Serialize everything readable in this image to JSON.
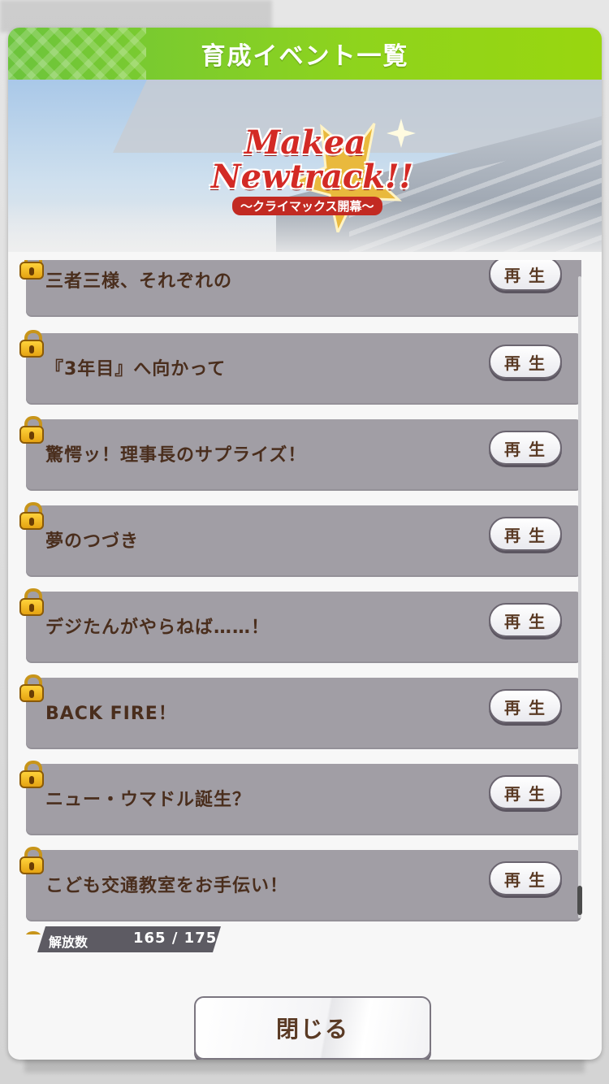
{
  "dialog": {
    "title": "育成イベント一覧"
  },
  "banner": {
    "logo_line1": "Makea",
    "logo_line2": "Newtrack!!",
    "logo_subtitle": "〜クライマックス開幕〜"
  },
  "events": [
    {
      "label": "三者三様、それぞれの",
      "play_label": "再生"
    },
    {
      "label": "『3年目』へ向かって",
      "play_label": "再生"
    },
    {
      "label": "驚愕ッ！理事長のサプライズ！",
      "play_label": "再生"
    },
    {
      "label": "夢のつづき",
      "play_label": "再生"
    },
    {
      "label": "デジたんがやらねば……！",
      "play_label": "再生"
    },
    {
      "label": "BACK FIRE！",
      "play_label": "再生"
    },
    {
      "label": "ニュー・ウマドル誕生？",
      "play_label": "再生"
    },
    {
      "label": "こども交通教室をお手伝い！",
      "play_label": "再生"
    }
  ],
  "unlock": {
    "label": "解放数",
    "value": "165 / 175"
  },
  "close_label": "閉じる",
  "icons": {
    "lock": "padlock-icon"
  },
  "colors": {
    "title_bar": "#8fd41c",
    "row_bg": "#a19ea5",
    "text_brown": "#4a2e1d"
  }
}
